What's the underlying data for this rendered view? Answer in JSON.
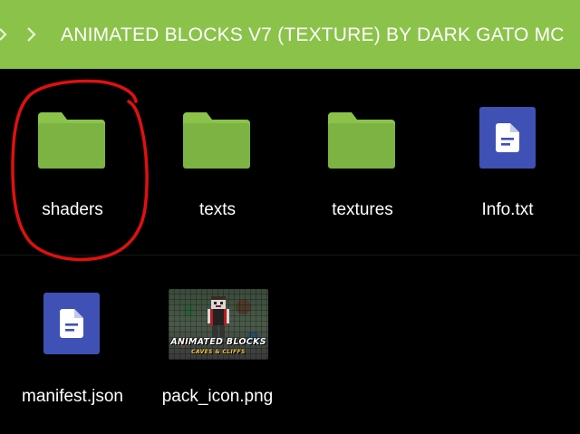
{
  "header": {
    "path_title": "ANIMATED BLOCKS V7 (TEXTURE) BY DARK GATO MC",
    "color": "#8bc34a"
  },
  "files": [
    {
      "name": "shaders",
      "type": "folder",
      "icon": "folder-icon"
    },
    {
      "name": "texts",
      "type": "folder",
      "icon": "folder-icon"
    },
    {
      "name": "textures",
      "type": "folder",
      "icon": "folder-icon"
    },
    {
      "name": "Info.txt",
      "type": "document",
      "icon": "document-icon"
    },
    {
      "name": "manifest.json",
      "type": "document",
      "icon": "document-icon"
    },
    {
      "name": "pack_icon.png",
      "type": "image",
      "icon": "image-thumbnail"
    }
  ],
  "thumbnail": {
    "title": "ANIMATED BLOCKS",
    "subtitle": "CAVES & CLIFFS"
  },
  "colors": {
    "folder": "#8bc34a",
    "document": "#3f51b5",
    "annotation": "#e01010"
  }
}
